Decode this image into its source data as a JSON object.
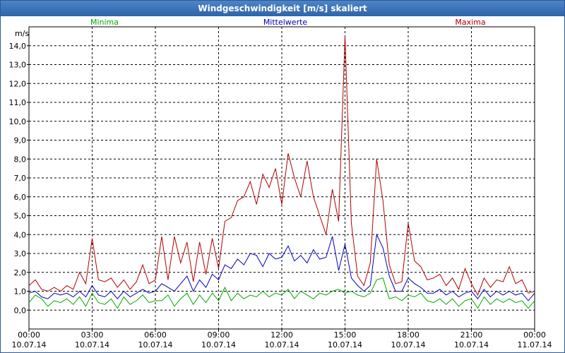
{
  "window": {
    "title": "Windgeschwindigkeit [m/s] skaliert"
  },
  "chart_data": {
    "type": "line",
    "title": "Windgeschwindigkeit [m/s] skaliert",
    "ylabel": "m/s",
    "xlabel": "",
    "ylim": [
      -1,
      15
    ],
    "y_ticks": [
      0,
      1,
      2,
      3,
      4,
      5,
      6,
      7,
      8,
      9,
      10,
      11,
      12,
      13,
      14
    ],
    "y_tick_labels": [
      "0,0",
      "1,0",
      "2,0",
      "3,0",
      "4,0",
      "5,0",
      "6,0",
      "7,0",
      "8,0",
      "9,0",
      "10,0",
      "11,0",
      "12,0",
      "13,0",
      "14,0"
    ],
    "grid": true,
    "x_unit": "hours since 10.07.14 00:00",
    "xlim": [
      0,
      24
    ],
    "x_ticks": [
      {
        "x": 0,
        "time": "00:00",
        "date": "10.07.14"
      },
      {
        "x": 3,
        "time": "03:00",
        "date": "10.07.14"
      },
      {
        "x": 6,
        "time": "06:00",
        "date": "10.07.14"
      },
      {
        "x": 9,
        "time": "09:00",
        "date": "10.07.14"
      },
      {
        "x": 12,
        "time": "12:00",
        "date": "10.07.14"
      },
      {
        "x": 15,
        "time": "15:00",
        "date": "10.07.14"
      },
      {
        "x": 18,
        "time": "18:00",
        "date": "10.07.14"
      },
      {
        "x": 21,
        "time": "21:00",
        "date": "10.07.14"
      },
      {
        "x": 24,
        "time": "00:00",
        "date": "11.07.14"
      }
    ],
    "series": [
      {
        "name": "Minima",
        "color": "#00aa00",
        "legend_position": "left",
        "points": [
          [
            0,
            0.4
          ],
          [
            0.3,
            0.8
          ],
          [
            0.6,
            0.6
          ],
          [
            0.9,
            0.2
          ],
          [
            1.2,
            0.5
          ],
          [
            1.5,
            0.4
          ],
          [
            1.8,
            0.6
          ],
          [
            2.1,
            0.3
          ],
          [
            2.4,
            0.7
          ],
          [
            2.7,
            0.2
          ],
          [
            3.0,
            0.9
          ],
          [
            3.3,
            0.4
          ],
          [
            3.6,
            0.3
          ],
          [
            3.9,
            0.6
          ],
          [
            4.2,
            0.1
          ],
          [
            4.5,
            0.7
          ],
          [
            4.8,
            0.3
          ],
          [
            5.1,
            0.5
          ],
          [
            5.4,
            0.8
          ],
          [
            5.7,
            0.4
          ],
          [
            6.0,
            0.5
          ],
          [
            6.3,
            0.5
          ],
          [
            6.6,
            0.8
          ],
          [
            6.9,
            0.2
          ],
          [
            7.2,
            0.6
          ],
          [
            7.5,
            0.9
          ],
          [
            7.8,
            0.3
          ],
          [
            8.1,
            0.8
          ],
          [
            8.4,
            0.4
          ],
          [
            8.7,
            0.9
          ],
          [
            9.0,
            0.5
          ],
          [
            9.3,
            1.2
          ],
          [
            9.6,
            0.5
          ],
          [
            9.9,
            0.9
          ],
          [
            10.2,
            0.6
          ],
          [
            10.5,
            0.8
          ],
          [
            10.8,
            0.7
          ],
          [
            11.1,
            1.0
          ],
          [
            11.4,
            0.7
          ],
          [
            11.7,
            0.9
          ],
          [
            12.0,
            0.8
          ],
          [
            12.3,
            1.1
          ],
          [
            12.6,
            0.6
          ],
          [
            12.9,
            1.0
          ],
          [
            13.2,
            0.8
          ],
          [
            13.5,
            0.6
          ],
          [
            13.8,
            0.9
          ],
          [
            14.1,
            0.8
          ],
          [
            14.4,
            1.0
          ],
          [
            14.7,
            1.1
          ],
          [
            15.0,
            0.9
          ],
          [
            15.3,
            1.0
          ],
          [
            15.6,
            0.8
          ],
          [
            15.9,
            0.7
          ],
          [
            16.2,
            0.9
          ],
          [
            16.5,
            1.6
          ],
          [
            16.8,
            1.7
          ],
          [
            17.1,
            0.6
          ],
          [
            17.4,
            0.7
          ],
          [
            17.7,
            0.5
          ],
          [
            18.0,
            0.8
          ],
          [
            18.3,
            0.7
          ],
          [
            18.6,
            0.9
          ],
          [
            18.9,
            0.5
          ],
          [
            19.2,
            0.4
          ],
          [
            19.5,
            0.6
          ],
          [
            19.8,
            0.3
          ],
          [
            20.1,
            0.6
          ],
          [
            20.4,
            0.2
          ],
          [
            20.7,
            0.5
          ],
          [
            21.0,
            0.6
          ],
          [
            21.3,
            0.1
          ],
          [
            21.6,
            0.7
          ],
          [
            21.9,
            0.3
          ],
          [
            22.2,
            0.6
          ],
          [
            22.5,
            0.4
          ],
          [
            22.8,
            0.6
          ],
          [
            23.1,
            0.4
          ],
          [
            23.4,
            0.5
          ],
          [
            23.7,
            0.1
          ],
          [
            24.0,
            0.5
          ]
        ]
      },
      {
        "name": "Mittelwerte",
        "color": "#0000c0",
        "legend_position": "center",
        "points": [
          [
            0,
            0.9
          ],
          [
            0.3,
            1.0
          ],
          [
            0.6,
            0.7
          ],
          [
            0.9,
            0.6
          ],
          [
            1.2,
            0.9
          ],
          [
            1.5,
            0.8
          ],
          [
            1.8,
            0.9
          ],
          [
            2.1,
            0.7
          ],
          [
            2.4,
            1.0
          ],
          [
            2.7,
            0.7
          ],
          [
            3.0,
            1.3
          ],
          [
            3.3,
            0.8
          ],
          [
            3.6,
            0.7
          ],
          [
            3.9,
            1.0
          ],
          [
            4.2,
            0.6
          ],
          [
            4.5,
            1.0
          ],
          [
            4.8,
            0.7
          ],
          [
            5.1,
            0.9
          ],
          [
            5.4,
            1.1
          ],
          [
            5.7,
            0.9
          ],
          [
            6.0,
            1.0
          ],
          [
            6.3,
            1.4
          ],
          [
            6.6,
            1.2
          ],
          [
            6.9,
            1.0
          ],
          [
            7.2,
            1.4
          ],
          [
            7.5,
            1.8
          ],
          [
            7.8,
            1.0
          ],
          [
            8.1,
            1.6
          ],
          [
            8.4,
            1.2
          ],
          [
            8.7,
            1.9
          ],
          [
            9.0,
            1.6
          ],
          [
            9.3,
            2.4
          ],
          [
            9.6,
            2.2
          ],
          [
            9.9,
            2.7
          ],
          [
            10.2,
            2.4
          ],
          [
            10.5,
            3.0
          ],
          [
            10.8,
            2.9
          ],
          [
            11.1,
            2.3
          ],
          [
            11.4,
            3.0
          ],
          [
            11.7,
            2.7
          ],
          [
            12.0,
            2.8
          ],
          [
            12.3,
            3.4
          ],
          [
            12.6,
            2.6
          ],
          [
            12.9,
            2.9
          ],
          [
            13.2,
            2.5
          ],
          [
            13.5,
            3.2
          ],
          [
            13.8,
            2.7
          ],
          [
            14.1,
            2.8
          ],
          [
            14.4,
            3.9
          ],
          [
            14.7,
            2.1
          ],
          [
            15.0,
            3.5
          ],
          [
            15.3,
            1.7
          ],
          [
            15.6,
            1.3
          ],
          [
            15.9,
            1.0
          ],
          [
            16.2,
            1.3
          ],
          [
            16.5,
            4.0
          ],
          [
            16.8,
            3.3
          ],
          [
            17.1,
            1.8
          ],
          [
            17.4,
            1.0
          ],
          [
            17.7,
            1.0
          ],
          [
            18.0,
            1.7
          ],
          [
            18.3,
            1.4
          ],
          [
            18.6,
            1.2
          ],
          [
            18.9,
            0.9
          ],
          [
            19.2,
            0.9
          ],
          [
            19.5,
            1.1
          ],
          [
            19.8,
            0.8
          ],
          [
            20.1,
            1.0
          ],
          [
            20.4,
            0.7
          ],
          [
            20.7,
            0.9
          ],
          [
            21.0,
            1.0
          ],
          [
            21.3,
            0.6
          ],
          [
            21.6,
            1.1
          ],
          [
            21.9,
            0.7
          ],
          [
            22.2,
            1.0
          ],
          [
            22.5,
            0.8
          ],
          [
            22.8,
            1.0
          ],
          [
            23.1,
            0.8
          ],
          [
            23.4,
            0.9
          ],
          [
            23.7,
            0.5
          ],
          [
            24.0,
            0.9
          ]
        ]
      },
      {
        "name": "Maxima",
        "color": "#b00000",
        "legend_position": "right",
        "points": [
          [
            0,
            1.3
          ],
          [
            0.3,
            1.6
          ],
          [
            0.6,
            1.1
          ],
          [
            0.9,
            1.0
          ],
          [
            1.2,
            1.2
          ],
          [
            1.5,
            1.0
          ],
          [
            1.8,
            1.3
          ],
          [
            2.1,
            1.1
          ],
          [
            2.4,
            2.0
          ],
          [
            2.7,
            1.4
          ],
          [
            3.0,
            3.8
          ],
          [
            3.3,
            1.6
          ],
          [
            3.6,
            1.5
          ],
          [
            3.9,
            1.7
          ],
          [
            4.2,
            1.2
          ],
          [
            4.5,
            1.6
          ],
          [
            4.8,
            1.1
          ],
          [
            5.1,
            1.5
          ],
          [
            5.4,
            2.4
          ],
          [
            5.7,
            1.4
          ],
          [
            6.0,
            1.6
          ],
          [
            6.3,
            3.9
          ],
          [
            6.6,
            1.6
          ],
          [
            6.9,
            3.9
          ],
          [
            7.2,
            2.5
          ],
          [
            7.5,
            3.6
          ],
          [
            7.8,
            1.5
          ],
          [
            8.1,
            3.6
          ],
          [
            8.4,
            1.9
          ],
          [
            8.7,
            3.8
          ],
          [
            9.0,
            2.2
          ],
          [
            9.3,
            4.7
          ],
          [
            9.6,
            4.9
          ],
          [
            9.9,
            5.8
          ],
          [
            10.2,
            6.0
          ],
          [
            10.5,
            6.8
          ],
          [
            10.8,
            5.6
          ],
          [
            11.1,
            7.2
          ],
          [
            11.4,
            6.5
          ],
          [
            11.7,
            7.5
          ],
          [
            12.0,
            5.6
          ],
          [
            12.3,
            8.3
          ],
          [
            12.6,
            7.0
          ],
          [
            12.9,
            6.0
          ],
          [
            13.2,
            7.9
          ],
          [
            13.5,
            6.0
          ],
          [
            13.8,
            5.0
          ],
          [
            14.1,
            4.0
          ],
          [
            14.4,
            6.4
          ],
          [
            14.7,
            4.7
          ],
          [
            15.0,
            14.5
          ],
          [
            15.3,
            4.6
          ],
          [
            15.6,
            1.8
          ],
          [
            15.9,
            1.3
          ],
          [
            16.2,
            2.5
          ],
          [
            16.5,
            8.0
          ],
          [
            16.8,
            5.8
          ],
          [
            17.1,
            2.4
          ],
          [
            17.4,
            1.4
          ],
          [
            17.7,
            1.5
          ],
          [
            18.0,
            4.6
          ],
          [
            18.3,
            2.6
          ],
          [
            18.6,
            2.3
          ],
          [
            18.9,
            1.6
          ],
          [
            19.2,
            1.7
          ],
          [
            19.5,
            1.9
          ],
          [
            19.8,
            1.3
          ],
          [
            20.1,
            1.7
          ],
          [
            20.4,
            1.1
          ],
          [
            20.7,
            2.2
          ],
          [
            21.0,
            1.4
          ],
          [
            21.3,
            0.8
          ],
          [
            21.6,
            1.7
          ],
          [
            21.9,
            1.2
          ],
          [
            22.2,
            1.6
          ],
          [
            22.5,
            1.5
          ],
          [
            22.8,
            2.3
          ],
          [
            23.1,
            1.4
          ],
          [
            23.4,
            1.6
          ],
          [
            23.7,
            0.9
          ],
          [
            24.0,
            1.0
          ]
        ]
      }
    ]
  }
}
